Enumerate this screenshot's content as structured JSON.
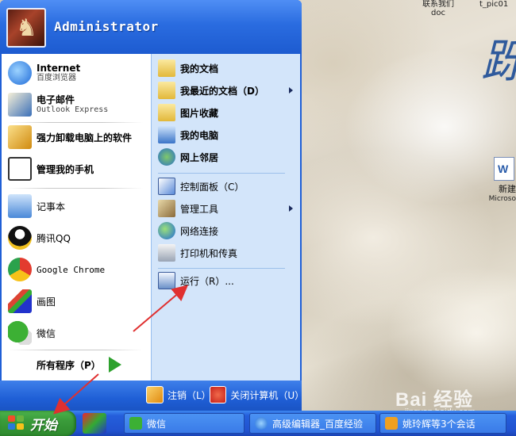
{
  "desktop": {
    "top_labels": [
      "联系我们",
      "t_pic01"
    ],
    "top_sublabel": "doc",
    "calligraphy": "跞",
    "file_icon": {
      "label": "新建",
      "sublabel": "Microso"
    },
    "watermark": "Bai 经验",
    "watermark_url": "jingyan.baidu.com"
  },
  "start_menu": {
    "username": "Administrator",
    "pinned": [
      {
        "title": "Internet",
        "subtitle": "百度浏览器",
        "icon": "browser-icon",
        "color": "#1e90ff"
      },
      {
        "title": "电子邮件",
        "subtitle": "Outlook Express",
        "icon": "mail-icon",
        "color": "#3a6fb8"
      }
    ],
    "recent": [
      {
        "label": "强力卸载电脑上的软件",
        "icon": "uninstall-icon",
        "color": "#e0a020",
        "bold": true
      },
      {
        "label": "管理我的手机",
        "icon": "phone-manager-icon",
        "color": "#333",
        "bold": true
      },
      {
        "label": "记事本",
        "icon": "notepad-icon",
        "color": "#4a88d8",
        "bold": false
      },
      {
        "label": "腾讯QQ",
        "icon": "qq-icon",
        "color": "#111",
        "bold": false
      },
      {
        "label": "Google Chrome",
        "icon": "chrome-icon",
        "color": "#e33b2e",
        "bold": false
      },
      {
        "label": "画图",
        "icon": "paint-icon",
        "color": "#d43",
        "bold": false
      },
      {
        "label": "微信",
        "icon": "wechat-icon",
        "color": "#3cb034",
        "bold": false
      }
    ],
    "all_programs": "所有程序（P）",
    "right_group1": [
      {
        "label": "我的文档",
        "icon": "folder-icon",
        "submenu": false
      },
      {
        "label": "我最近的文档（D）",
        "icon": "recent-docs-icon",
        "submenu": true
      },
      {
        "label": "图片收藏",
        "icon": "pictures-icon",
        "submenu": false
      },
      {
        "label": "我的电脑",
        "icon": "computer-icon",
        "submenu": false
      },
      {
        "label": "网上邻居",
        "icon": "network-places-icon",
        "submenu": false
      }
    ],
    "right_group2": [
      {
        "label": "控制面板（C）",
        "icon": "control-panel-icon",
        "submenu": false
      },
      {
        "label": "管理工具",
        "icon": "admin-tools-icon",
        "submenu": true
      },
      {
        "label": "网络连接",
        "icon": "network-connections-icon",
        "submenu": false
      },
      {
        "label": "打印机和传真",
        "icon": "printer-icon",
        "submenu": false
      }
    ],
    "right_group3": [
      {
        "label": "运行（R）...",
        "icon": "run-icon",
        "submenu": false
      }
    ],
    "logoff": "注销（L）",
    "shutdown": "关闭计算机（U）"
  },
  "taskbar": {
    "start_label": "开始",
    "buttons": [
      {
        "label": "微信",
        "icon": "wechat-icon",
        "color": "#3cb034"
      },
      {
        "label": "高级编辑器_百度经验",
        "icon": "browser-icon",
        "color": "#1e90ff"
      },
      {
        "label": "姚玲辉等3个会话",
        "icon": "chat-icon",
        "color": "#f0a020"
      }
    ]
  },
  "colors": {
    "taskbar_blue": "#245edb",
    "start_green": "#3a9b3a",
    "menu_right_bg": "#d3e5fa",
    "annotation_red": "#e03030"
  }
}
